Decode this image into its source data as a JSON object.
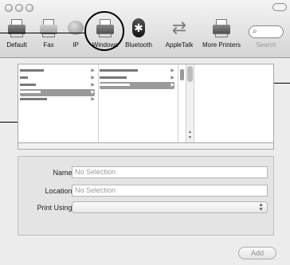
{
  "toolbar": {
    "items": [
      {
        "label": "Default",
        "icon": "default-printer-icon"
      },
      {
        "label": "Fax",
        "icon": "fax-icon"
      },
      {
        "label": "IP",
        "icon": "ip-printer-icon"
      },
      {
        "label": "Windows",
        "icon": "windows-printer-icon"
      },
      {
        "label": "Bluetooth",
        "icon": "bluetooth-icon"
      },
      {
        "label": "AppleTalk",
        "icon": "appletalk-icon"
      },
      {
        "label": "More Printers",
        "icon": "more-printers-icon"
      },
      {
        "label": "Search",
        "icon": "search-icon"
      }
    ],
    "selected": "Windows"
  },
  "details": {
    "name_label": "Name:",
    "name_placeholder": "No Selection",
    "location_label": "Location:",
    "location_placeholder": "No Selection",
    "print_using_label": "Print Using:"
  },
  "buttons": {
    "add": "Add"
  },
  "colors": {
    "window_bg": "#ececec",
    "selection": "#9a9a9a",
    "callout": "#000000"
  }
}
